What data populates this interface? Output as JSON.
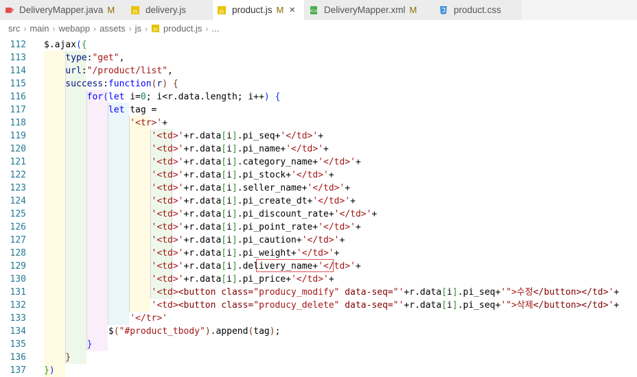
{
  "tabs": [
    {
      "label": "DeliveryMapper.java",
      "mod": "M",
      "icon": "java-file-icon",
      "color": "#e05050"
    },
    {
      "label": "delivery.js",
      "mod": "",
      "icon": "js-file-icon",
      "color": "#d4b000"
    },
    {
      "label": "product.js",
      "mod": "M",
      "icon": "js-file-icon",
      "color": "#d4b000"
    },
    {
      "label": "DeliveryMapper.xml",
      "mod": "M",
      "icon": "xml-file-icon",
      "color": "#4caf50"
    },
    {
      "label": "product.css",
      "mod": "",
      "icon": "css-file-icon",
      "color": "#3f8fd8"
    }
  ],
  "active_tab_close": "×",
  "breadcrumb": [
    "src",
    "main",
    "webapp",
    "assets",
    "js",
    "product.js",
    "..."
  ],
  "editor": {
    "lines": [
      {
        "n": "112",
        "toks": [
          [
            "",
            "    $.ajax"
          ],
          [
            "t-p1",
            "("
          ],
          [
            "t-p2",
            "{"
          ]
        ]
      },
      {
        "n": "113",
        "toks": [
          [
            "t-var",
            "        type"
          ],
          [
            "",
            ":"
          ],
          [
            "t-str",
            "\"get\""
          ],
          [
            "",
            ","
          ]
        ]
      },
      {
        "n": "114",
        "toks": [
          [
            "t-var",
            "        url"
          ],
          [
            "",
            ":"
          ],
          [
            "t-str",
            "\"/product/list\""
          ],
          [
            "",
            ","
          ]
        ]
      },
      {
        "n": "115",
        "toks": [
          [
            "t-var",
            "        success"
          ],
          [
            "",
            ":"
          ],
          [
            "t-kw",
            "function"
          ],
          [
            "t-p3",
            "("
          ],
          [
            "t-var",
            "r"
          ],
          [
            "t-p3",
            ")"
          ],
          [
            "",
            " "
          ],
          [
            "t-p3",
            "{"
          ]
        ]
      },
      {
        "n": "116",
        "toks": [
          [
            "t-kw",
            "            for"
          ],
          [
            "t-p1",
            "("
          ],
          [
            "t-kw",
            "let"
          ],
          [
            "",
            " i="
          ],
          [
            "t-num",
            "0"
          ],
          [
            "",
            "; i<r.data.length; i++"
          ],
          [
            "t-p1",
            ")"
          ],
          [
            "",
            " "
          ],
          [
            "t-p1",
            "{"
          ]
        ]
      },
      {
        "n": "117",
        "toks": [
          [
            "t-kw",
            "                let"
          ],
          [
            "",
            " tag ="
          ]
        ]
      },
      {
        "n": "118",
        "toks": [
          [
            "t-str",
            "                    '<tr>'"
          ],
          [
            "",
            "+"
          ]
        ]
      },
      {
        "n": "119",
        "toks": [
          [
            "t-str",
            "                        '<td>'"
          ],
          [
            "",
            "+r.data"
          ],
          [
            "t-p2",
            "["
          ],
          [
            "",
            "i"
          ],
          [
            "t-p2",
            "]"
          ],
          [
            "",
            ".pi_seq+"
          ],
          [
            "t-str",
            "'</td>'"
          ],
          [
            "",
            "+"
          ]
        ]
      },
      {
        "n": "120",
        "toks": [
          [
            "t-str",
            "                        '<td>'"
          ],
          [
            "",
            "+r.data"
          ],
          [
            "t-p2",
            "["
          ],
          [
            "",
            "i"
          ],
          [
            "t-p2",
            "]"
          ],
          [
            "",
            ".pi_name+"
          ],
          [
            "t-str",
            "'</td>'"
          ],
          [
            "",
            "+"
          ]
        ]
      },
      {
        "n": "121",
        "toks": [
          [
            "t-str",
            "                        '<td>'"
          ],
          [
            "",
            "+r.data"
          ],
          [
            "t-p2",
            "["
          ],
          [
            "",
            "i"
          ],
          [
            "t-p2",
            "]"
          ],
          [
            "",
            ".category_name+"
          ],
          [
            "t-str",
            "'</td>'"
          ],
          [
            "",
            "+"
          ]
        ]
      },
      {
        "n": "122",
        "toks": [
          [
            "t-str",
            "                        '<td>'"
          ],
          [
            "",
            "+r.data"
          ],
          [
            "t-p2",
            "["
          ],
          [
            "",
            "i"
          ],
          [
            "t-p2",
            "]"
          ],
          [
            "",
            ".pi_stock+"
          ],
          [
            "t-str",
            "'</td>'"
          ],
          [
            "",
            "+"
          ]
        ]
      },
      {
        "n": "123",
        "toks": [
          [
            "t-str",
            "                        '<td>'"
          ],
          [
            "",
            "+r.data"
          ],
          [
            "t-p2",
            "["
          ],
          [
            "",
            "i"
          ],
          [
            "t-p2",
            "]"
          ],
          [
            "",
            ".seller_name+"
          ],
          [
            "t-str",
            "'</td>'"
          ],
          [
            "",
            "+"
          ]
        ]
      },
      {
        "n": "124",
        "toks": [
          [
            "t-str",
            "                        '<td>'"
          ],
          [
            "",
            "+r.data"
          ],
          [
            "t-p2",
            "["
          ],
          [
            "",
            "i"
          ],
          [
            "t-p2",
            "]"
          ],
          [
            "",
            ".pi_create_dt+"
          ],
          [
            "t-str",
            "'</td>'"
          ],
          [
            "",
            "+"
          ]
        ]
      },
      {
        "n": "125",
        "toks": [
          [
            "t-str",
            "                        '<td>'"
          ],
          [
            "",
            "+r.data"
          ],
          [
            "t-p2",
            "["
          ],
          [
            "",
            "i"
          ],
          [
            "t-p2",
            "]"
          ],
          [
            "",
            ".pi_discount_rate+"
          ],
          [
            "t-str",
            "'</td>'"
          ],
          [
            "",
            "+"
          ]
        ]
      },
      {
        "n": "126",
        "toks": [
          [
            "t-str",
            "                        '<td>'"
          ],
          [
            "",
            "+r.data"
          ],
          [
            "t-p2",
            "["
          ],
          [
            "",
            "i"
          ],
          [
            "t-p2",
            "]"
          ],
          [
            "",
            ".pi_point_rate+"
          ],
          [
            "t-str",
            "'</td>'"
          ],
          [
            "",
            "+"
          ]
        ]
      },
      {
        "n": "127",
        "toks": [
          [
            "t-str",
            "                        '<td>'"
          ],
          [
            "",
            "+r.data"
          ],
          [
            "t-p2",
            "["
          ],
          [
            "",
            "i"
          ],
          [
            "t-p2",
            "]"
          ],
          [
            "",
            ".pi_caution+"
          ],
          [
            "t-str",
            "'</td>'"
          ],
          [
            "",
            "+"
          ]
        ]
      },
      {
        "n": "128",
        "toks": [
          [
            "t-str",
            "                        '<td>'"
          ],
          [
            "",
            "+r.data"
          ],
          [
            "t-p2",
            "["
          ],
          [
            "",
            "i"
          ],
          [
            "t-p2",
            "]"
          ],
          [
            "",
            ".pi_weight+"
          ],
          [
            "t-str",
            "'</td>'"
          ],
          [
            "",
            "+"
          ]
        ]
      },
      {
        "n": "129",
        "toks": [
          [
            "t-str",
            "                        '<td>'"
          ],
          [
            "",
            "+r.data"
          ],
          [
            "t-p2",
            "["
          ],
          [
            "",
            "i"
          ],
          [
            "t-p2",
            "]"
          ],
          [
            "",
            ".delivery_name+"
          ],
          [
            "t-str",
            "'</td>'"
          ],
          [
            "",
            "+"
          ]
        ]
      },
      {
        "n": "130",
        "toks": [
          [
            "t-str",
            "                        '<td>'"
          ],
          [
            "",
            "+r.data"
          ],
          [
            "t-p2",
            "["
          ],
          [
            "",
            "i"
          ],
          [
            "t-p2",
            "]"
          ],
          [
            "",
            ".pi_price+"
          ],
          [
            "t-str",
            "'</td>'"
          ],
          [
            "",
            "+"
          ]
        ]
      },
      {
        "n": "131",
        "toks": [
          [
            "t-str",
            "                        '<td>"
          ],
          [
            "t-tag",
            "<button class="
          ],
          [
            "t-str",
            "\"producy_modify\""
          ],
          [
            "t-tag",
            " data-seq="
          ],
          [
            "t-str",
            "\"'"
          ],
          [
            "",
            "+r.data"
          ],
          [
            "t-p2",
            "["
          ],
          [
            "",
            "i"
          ],
          [
            "t-p2",
            "]"
          ],
          [
            "",
            ".pi_seq+"
          ],
          [
            "t-str",
            "'\">수정"
          ],
          [
            "t-tag",
            "</button></td>"
          ],
          [
            "t-str",
            "'"
          ],
          [
            "",
            "+"
          ]
        ]
      },
      {
        "n": "132",
        "toks": [
          [
            "t-str",
            "                        '<td>"
          ],
          [
            "t-tag",
            "<button class="
          ],
          [
            "t-str",
            "\"producy_delete\""
          ],
          [
            "t-tag",
            " data-seq="
          ],
          [
            "t-str",
            "\"'"
          ],
          [
            "",
            "+r.data"
          ],
          [
            "t-p2",
            "["
          ],
          [
            "",
            "i"
          ],
          [
            "t-p2",
            "]"
          ],
          [
            "",
            ".pi_seq+"
          ],
          [
            "t-str",
            "'\">삭제"
          ],
          [
            "t-tag",
            "</button></td>"
          ],
          [
            "t-str",
            "'"
          ],
          [
            "",
            "+"
          ]
        ]
      },
      {
        "n": "133",
        "toks": [
          [
            "t-str",
            "                    '</tr>'"
          ]
        ]
      },
      {
        "n": "134",
        "toks": [
          [
            "",
            "                $"
          ],
          [
            "t-p3",
            "("
          ],
          [
            "t-str",
            "\"#product_tbody\""
          ],
          [
            "t-p3",
            ")"
          ],
          [
            "",
            ".append"
          ],
          [
            "t-p3",
            "("
          ],
          [
            "",
            "tag"
          ],
          [
            "t-p3",
            ")"
          ],
          [
            "",
            ";"
          ]
        ]
      },
      {
        "n": "135",
        "toks": [
          [
            "t-p1",
            "            }"
          ]
        ]
      },
      {
        "n": "136",
        "toks": [
          [
            "t-p3",
            "        }"
          ]
        ]
      },
      {
        "n": "137",
        "toks": [
          [
            "t-p2",
            "    }"
          ],
          [
            "t-p1",
            ")"
          ]
        ]
      }
    ]
  }
}
